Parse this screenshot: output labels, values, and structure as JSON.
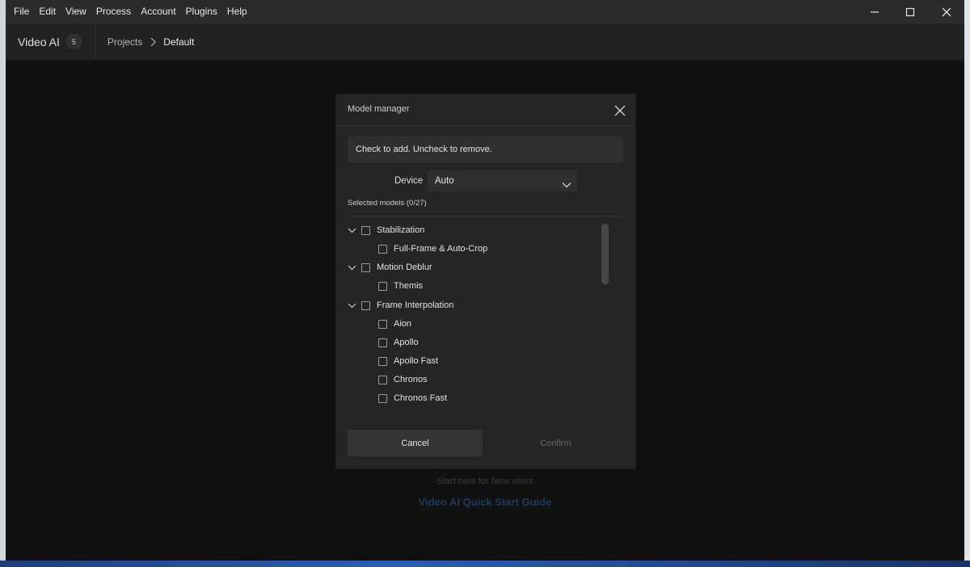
{
  "menubar": {
    "items": [
      "File",
      "Edit",
      "View",
      "Process",
      "Account",
      "Plugins",
      "Help"
    ]
  },
  "window_controls": [
    "minimize-icon",
    "maximize-icon",
    "close-icon"
  ],
  "header": {
    "app_name": "Video AI",
    "badge": "5",
    "breadcrumb": [
      "Projects",
      "Default"
    ]
  },
  "background": {
    "start_here": "Start here for New users",
    "guide_link": "Video AI Quick Start Guide"
  },
  "modal": {
    "title": "Model manager",
    "hint": "Check to add. Uncheck to remove.",
    "device_label": "Device",
    "device_value": "Auto",
    "selected_count": "Selected models (0/27)",
    "groups": [
      {
        "label": "Stabilization",
        "checked": false,
        "expanded": true,
        "models": [
          {
            "label": "Full-Frame & Auto-Crop",
            "checked": false
          }
        ]
      },
      {
        "label": "Motion Deblur",
        "checked": false,
        "expanded": true,
        "models": [
          {
            "label": "Themis",
            "checked": false
          }
        ]
      },
      {
        "label": "Frame Interpolation",
        "checked": false,
        "expanded": true,
        "models": [
          {
            "label": "Aion",
            "checked": false
          },
          {
            "label": "Apollo",
            "checked": false
          },
          {
            "label": "Apollo Fast",
            "checked": false
          },
          {
            "label": "Chronos",
            "checked": false
          },
          {
            "label": "Chronos Fast",
            "checked": false
          }
        ]
      }
    ],
    "cancel_label": "Cancel",
    "confirm_label": "Confirm"
  },
  "colors": {
    "app_background": "#111111",
    "menubar": "#2b2b2b",
    "header": "#222222",
    "modal": "#252525",
    "link": "#1e3a5e"
  }
}
